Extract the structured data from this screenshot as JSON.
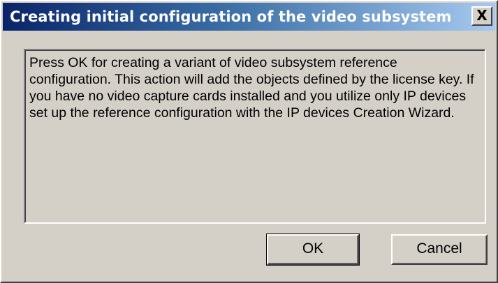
{
  "window": {
    "title": "Creating initial configuration of the video subsystem",
    "close_glyph": "X"
  },
  "message": {
    "text": "Press OK for creating a variant of video subsystem reference configuration. This action will add the objects defined by the license key. If you have no video capture cards installed and you utilize only IP devices set up the reference configuration with the IP devices Creation Wizard."
  },
  "buttons": {
    "ok_label": "OK",
    "cancel_label": "Cancel"
  },
  "colors": {
    "dialog_face": "#d4d0c8",
    "title_start": "#0a246a",
    "title_end": "#a6caf0",
    "title_text": "#ffffff"
  }
}
